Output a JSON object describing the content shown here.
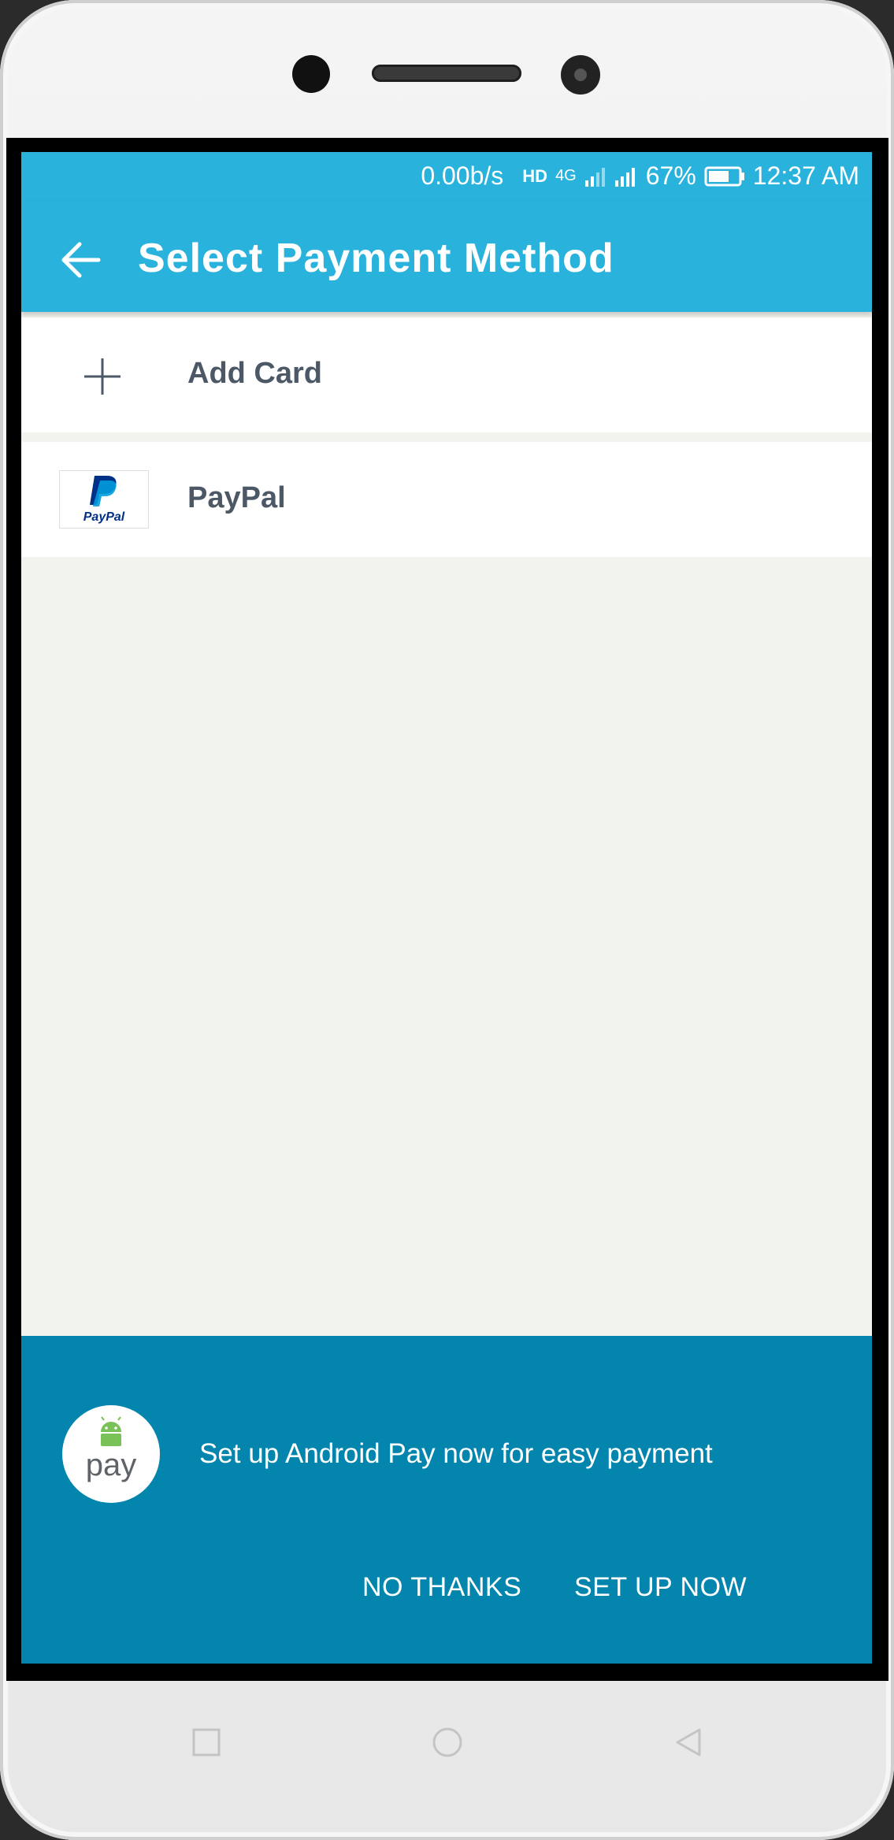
{
  "status_bar": {
    "net_speed": "0.00b/s",
    "network": "4G",
    "battery_percent": "67%",
    "time": "12:37 AM"
  },
  "app_bar": {
    "title": "Select Payment Method",
    "back_icon": "arrow-left-icon"
  },
  "payment_methods": [
    {
      "label": "Add Card",
      "icon": "plus-icon"
    },
    {
      "label": "PayPal",
      "icon": "paypal-logo"
    }
  ],
  "android_pay_banner": {
    "badge_text": "pay",
    "message": "Set up Android Pay now for easy payment",
    "no_thanks_label": "NO THANKS",
    "set_up_label": "SET UP NOW"
  },
  "nav_bar": [
    "square-icon",
    "circle-icon",
    "triangle-back-icon"
  ],
  "colors": {
    "primary": "#29b3dc",
    "banner": "#0485ad",
    "background": "#f2f2ef"
  }
}
